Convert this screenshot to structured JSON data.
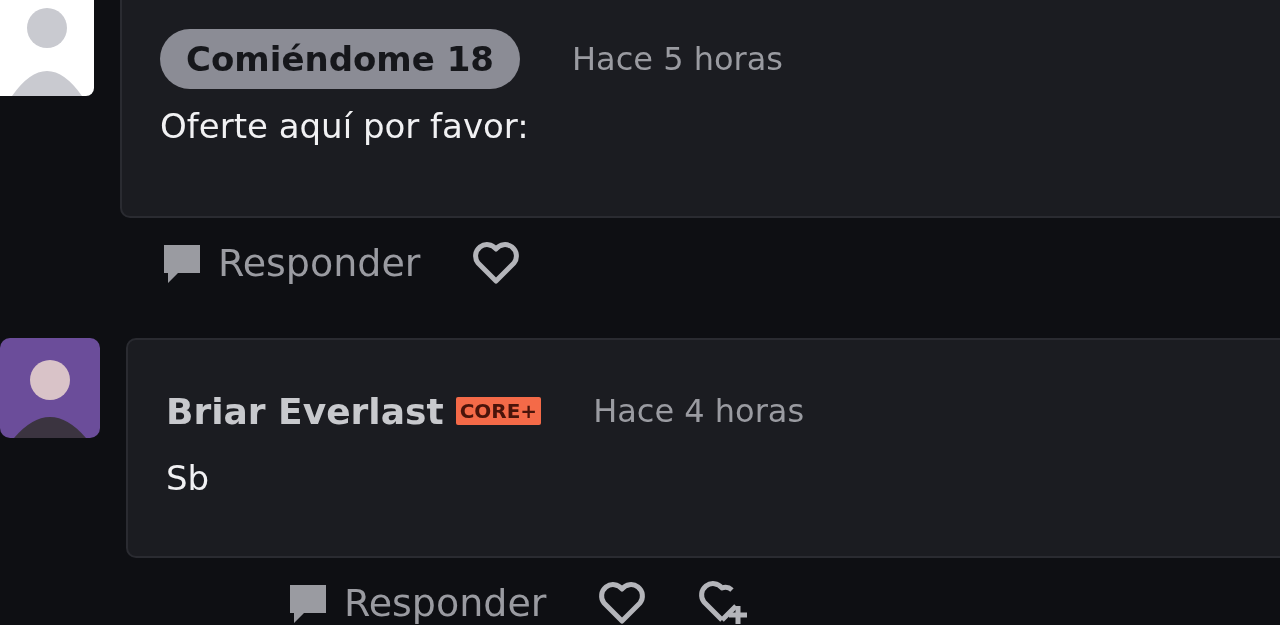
{
  "comments": [
    {
      "author": "Comiéndome 18",
      "author_highlighted": true,
      "time": "Hace 5 horas",
      "body": "Oferte aquí por favor:",
      "actions": [
        {
          "kind": "reply",
          "label": "Responder"
        },
        {
          "kind": "like"
        }
      ],
      "children": [
        {
          "author": "Briar Everlast",
          "author_highlighted": false,
          "badge": "CORE+",
          "time": "Hace 4 horas",
          "body": "Sb",
          "actions": [
            {
              "kind": "reply",
              "label": "Responder"
            },
            {
              "kind": "like"
            },
            {
              "kind": "award"
            }
          ]
        }
      ]
    }
  ]
}
